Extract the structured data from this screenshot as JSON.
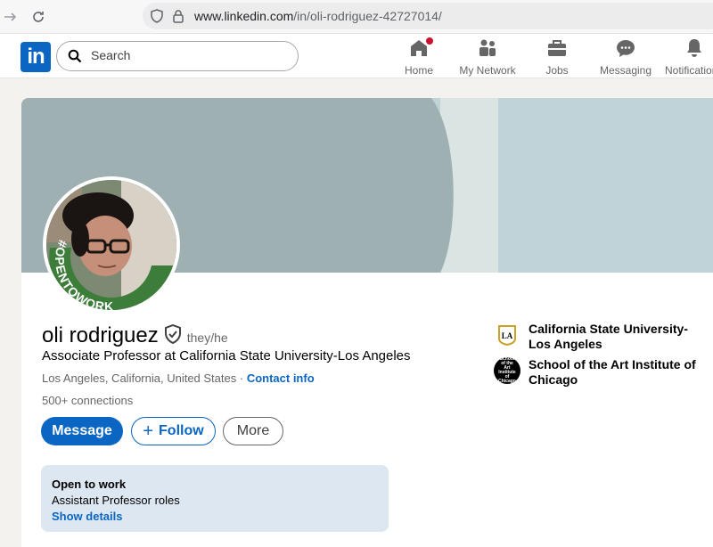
{
  "browser": {
    "url_host": "www.linkedin.com",
    "url_path": "/in/oli-rodriguez-42727014/"
  },
  "header": {
    "logo_text": "in",
    "search_placeholder": "Search",
    "nav": [
      {
        "label": "Home",
        "icon": "home-icon",
        "has_badge": true
      },
      {
        "label": "My Network",
        "icon": "network-icon"
      },
      {
        "label": "Jobs",
        "icon": "briefcase-icon"
      },
      {
        "label": "Messaging",
        "icon": "messaging-icon"
      },
      {
        "label": "Notifications",
        "icon": "bell-icon"
      }
    ]
  },
  "profile": {
    "name": "oli rodriguez",
    "pronouns": "they/he",
    "headline": "Associate Professor at California State University-Los Angeles",
    "location": "Los Angeles, California, United States",
    "location_separator": " · ",
    "contact_link": "Contact info",
    "connections": "500+ connections",
    "avatar_frame_text": "#OPENTOWORK",
    "buttons": {
      "message": "Message",
      "follow": "Follow",
      "more": "More"
    },
    "education": [
      {
        "name": "California State University-Los Angeles",
        "logo_text": "LA"
      },
      {
        "name": "School of the Art Institute of Chicago",
        "logo_text": "School of the Art Institute of Chicago"
      }
    ],
    "open_to_work": {
      "title": "Open to work",
      "roles": "Assistant Professor roles",
      "link": "Show details"
    }
  },
  "colors": {
    "brand": "#0a66c2",
    "open_to_work_green": "#3d7d3a",
    "banner_dark": "#9fb0b3",
    "banner_light": "#c0d3d8"
  }
}
